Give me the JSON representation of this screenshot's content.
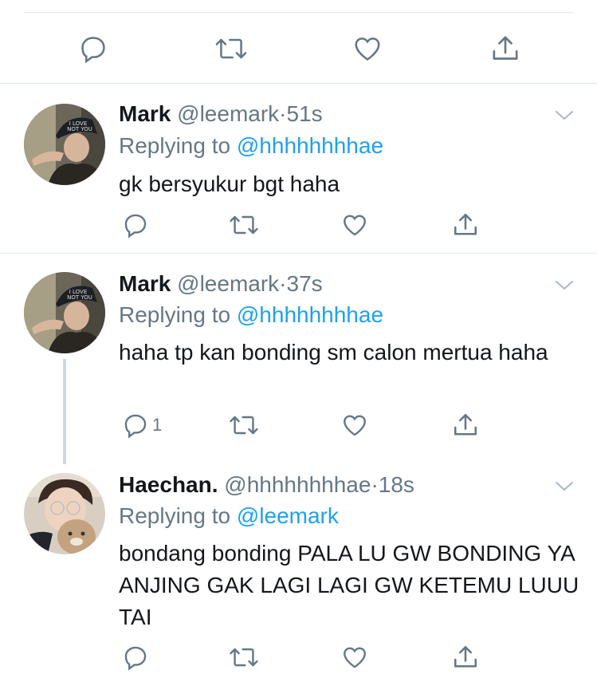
{
  "top_actions": {
    "reply_count": "",
    "retweet_count": "",
    "like_count": ""
  },
  "tweets": [
    {
      "name": "Mark",
      "handle": "@leemark",
      "dot": "·",
      "time": "51s",
      "replying_prefix": "Replying to",
      "replying_to": "@hhhhhhhhae",
      "text": "gk bersyukur bgt haha",
      "reply_count": ""
    },
    {
      "name": "Mark",
      "handle": "@leemark",
      "dot": "·",
      "time": "37s",
      "replying_prefix": "Replying to",
      "replying_to": "@hhhhhhhhae",
      "text": "haha tp kan bonding sm calon mertua haha",
      "reply_count": "1"
    },
    {
      "name": "Haechan.",
      "handle": "@hhhhhhhhae",
      "dot": "·",
      "time": "18s",
      "replying_prefix": "Replying to",
      "replying_to": "@leemark",
      "text": "bondang bonding PALA LU GW BONDING YA ANJING GAK LAGI LAGI GW KETEMU LUUU TAI",
      "reply_count": ""
    }
  ],
  "colors": {
    "link": "#1da1f2",
    "muted": "#657786",
    "divider": "#e1e8ed"
  },
  "icons": [
    "reply-icon",
    "retweet-icon",
    "like-icon",
    "share-icon",
    "chevron-down-icon"
  ]
}
